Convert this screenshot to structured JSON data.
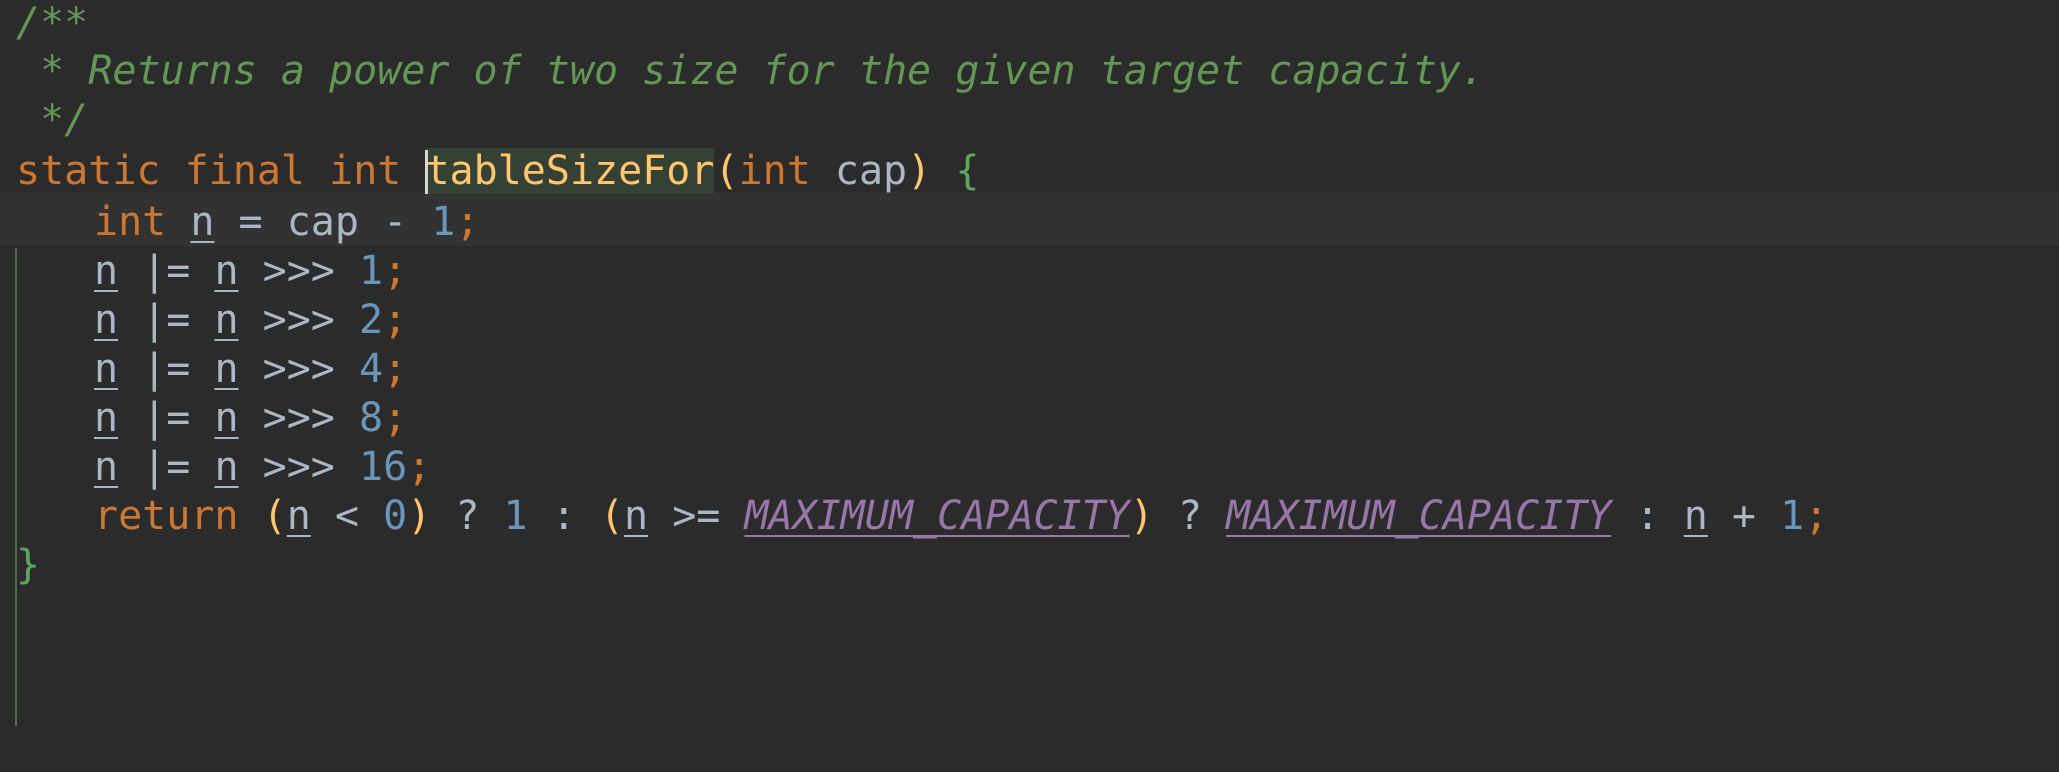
{
  "editor": {
    "language": "java",
    "background_color": "#2b2b2b",
    "current_line_color": "#323232",
    "caret_color": "#d6d6d6",
    "identifier_highlight_color": "#344134",
    "indent_guide_color": "#4f6b4f"
  },
  "palette": {
    "comment": "#629755",
    "keyword": "#cc7832",
    "method_name": "#ffc66d",
    "identifier": "#a9b7c6",
    "number": "#6897bb",
    "static_field": "#9876aa",
    "bracket": "#ffc66d",
    "brace": "#5ca85c",
    "semicolon": "#cc7832"
  },
  "code": {
    "line1": {
      "comment_open": "/**"
    },
    "line2": {
      "comment_body": " * Returns a power of two size for the given target capacity."
    },
    "line3": {
      "comment_close": " */"
    },
    "signature": {
      "kw_static": "static",
      "kw_final": "final",
      "kw_int": "int",
      "method_name": "tableSizeFor",
      "paren_open": "(",
      "param_type": "int",
      "param_name": "cap",
      "paren_close": ")",
      "brace_open": "{"
    },
    "body1": {
      "kw_int": "int",
      "var_n": "n",
      "op_assign": "=",
      "var_cap": "cap",
      "op_minus": "-",
      "num_one": "1",
      "semi": ";"
    },
    "shift_lines": [
      {
        "var_left": "n",
        "op": "|=",
        "var_right": "n",
        "shift_op": ">>>",
        "amount": "1",
        "semi": ";"
      },
      {
        "var_left": "n",
        "op": "|=",
        "var_right": "n",
        "shift_op": ">>>",
        "amount": "2",
        "semi": ";"
      },
      {
        "var_left": "n",
        "op": "|=",
        "var_right": "n",
        "shift_op": ">>>",
        "amount": "4",
        "semi": ";"
      },
      {
        "var_left": "n",
        "op": "|=",
        "var_right": "n",
        "shift_op": ">>>",
        "amount": "8",
        "semi": ";"
      },
      {
        "var_left": "n",
        "op": "|=",
        "var_right": "n",
        "shift_op": ">>>",
        "amount": "16",
        "semi": ";"
      }
    ],
    "return_line": {
      "kw_return": "return",
      "paren1_open": "(",
      "var_n1": "n",
      "op_lt": "<",
      "num_zero": "0",
      "paren1_close": ")",
      "question1": "?",
      "num_one": "1",
      "colon1": ":",
      "paren2_open": "(",
      "var_n2": "n",
      "op_gte": ">=",
      "const1": "MAXIMUM_CAPACITY",
      "paren2_close": ")",
      "question2": "?",
      "const2": "MAXIMUM_CAPACITY",
      "colon2": ":",
      "var_n3": "n",
      "op_plus": "+",
      "num_one_end": "1",
      "semi": ";"
    },
    "closing": {
      "brace_close": "}"
    }
  }
}
